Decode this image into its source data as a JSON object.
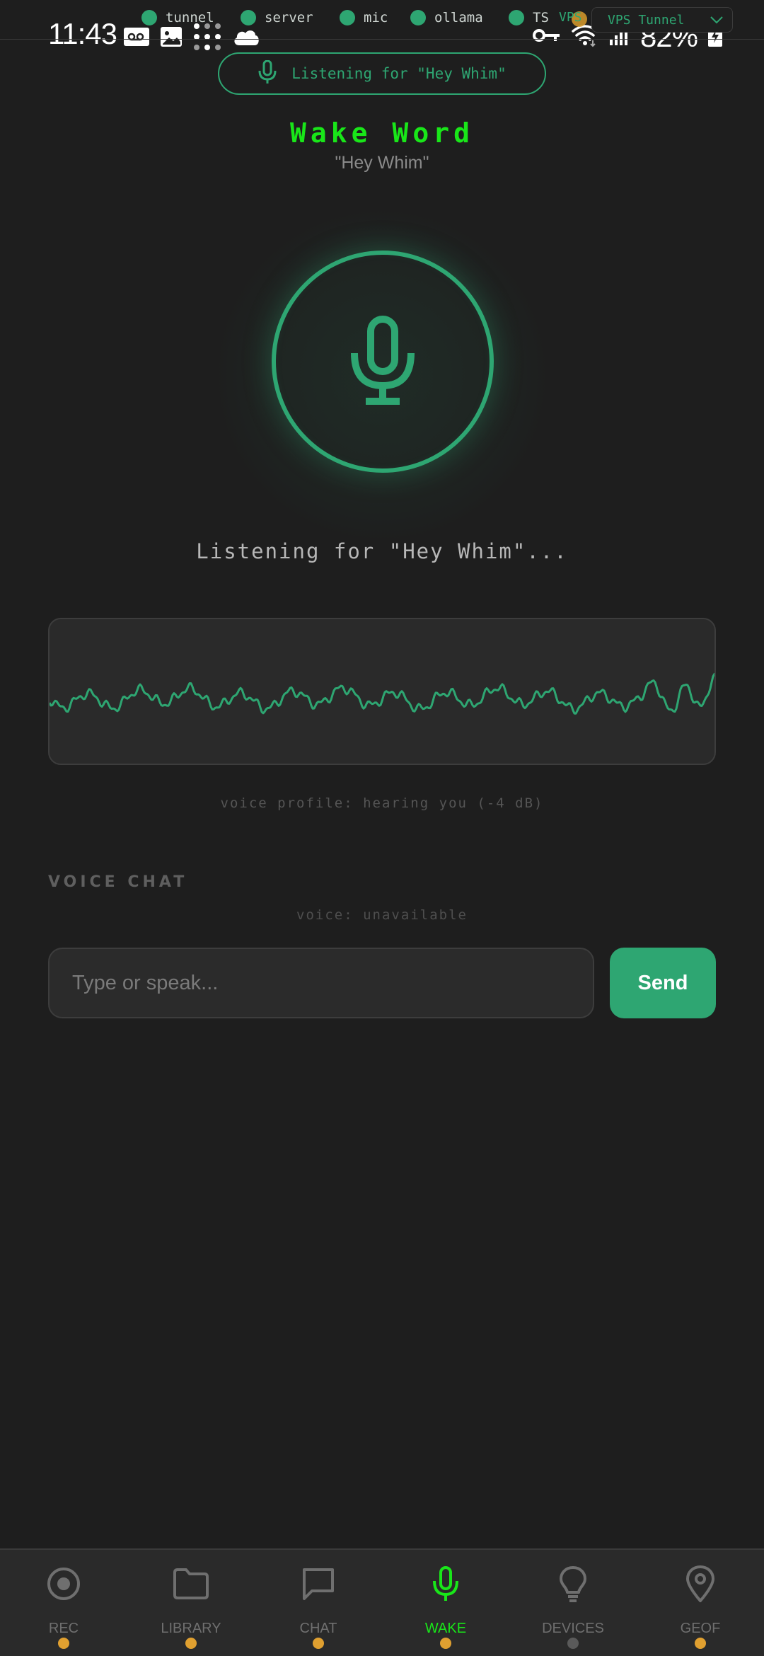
{
  "status_bar": {
    "time": "11:43",
    "battery": "82%"
  },
  "services": [
    {
      "label": "tunnel",
      "color": "#2ea672"
    },
    {
      "label": "server",
      "color": "#2ea672"
    },
    {
      "label": "mic",
      "color": "#2ea672"
    },
    {
      "label": "ollama",
      "color": "#2ea672"
    },
    {
      "label": "TS",
      "color": "#2ea672"
    }
  ],
  "vps": {
    "badge": "VPS",
    "dot_color": "#d89b2b",
    "selected": "VPS Tunnel"
  },
  "listening_pill": {
    "text": "Listening for \"Hey Whim\"",
    "icon": "mic-icon"
  },
  "wake": {
    "title": "Wake Word",
    "phrase": "\"Hey Whim\"",
    "status": "Listening for \"Hey Whim\"...",
    "voice_profile": "voice profile: hearing you (-4 dB)"
  },
  "voice_chat": {
    "section_label": "VOICE CHAT",
    "voice_status": "voice: unavailable",
    "input_placeholder": "Type or speak...",
    "input_value": "",
    "send_label": "Send"
  },
  "nav": [
    {
      "key": "rec",
      "label": "REC",
      "icon": "record-icon",
      "dot_color": "#e0a030",
      "active": false
    },
    {
      "key": "library",
      "label": "LIBRARY",
      "icon": "folder-icon",
      "dot_color": "#e0a030",
      "active": false
    },
    {
      "key": "chat",
      "label": "CHAT",
      "icon": "chat-bubble-icon",
      "dot_color": "#e0a030",
      "active": false
    },
    {
      "key": "wake",
      "label": "WAKE",
      "icon": "mic-icon",
      "dot_color": "#e0a030",
      "active": true
    },
    {
      "key": "devices",
      "label": "DEVICES",
      "icon": "lightbulb-icon",
      "dot_color": "#5a5a5a",
      "active": false
    },
    {
      "key": "geof",
      "label": "GEOF",
      "icon": "map-pin-icon",
      "dot_color": "#e0a030",
      "active": false
    }
  ],
  "colors": {
    "accent": "#2ea672",
    "active_nav": "#19e619",
    "background": "#1e1e1e"
  }
}
